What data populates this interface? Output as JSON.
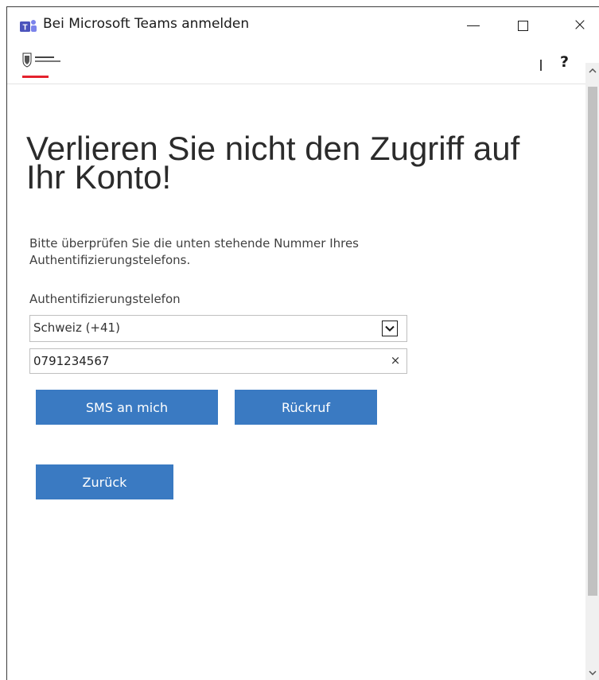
{
  "window": {
    "title": "Bei Microsoft Teams anmelden",
    "minimize_symbol": "",
    "close_symbol": "×"
  },
  "org_header": {
    "help_label": "?"
  },
  "content": {
    "heading": "Verlieren Sie nicht den Zugriff auf Ihr Konto!",
    "description": "Bitte überprüfen Sie die unten stehende Nummer Ihres Authentifizierungstelefons.",
    "phone_label": "Authentifizierungstelefon",
    "country_selected": "Schweiz (+41)",
    "phone_value": "0791234567",
    "clear_symbol": "×",
    "buttons": {
      "sms": "SMS an mich",
      "callback": "Rückruf",
      "back": "Zurück"
    }
  },
  "colors": {
    "button_blue": "#3a7ac2",
    "accent_red": "#e4222d"
  }
}
